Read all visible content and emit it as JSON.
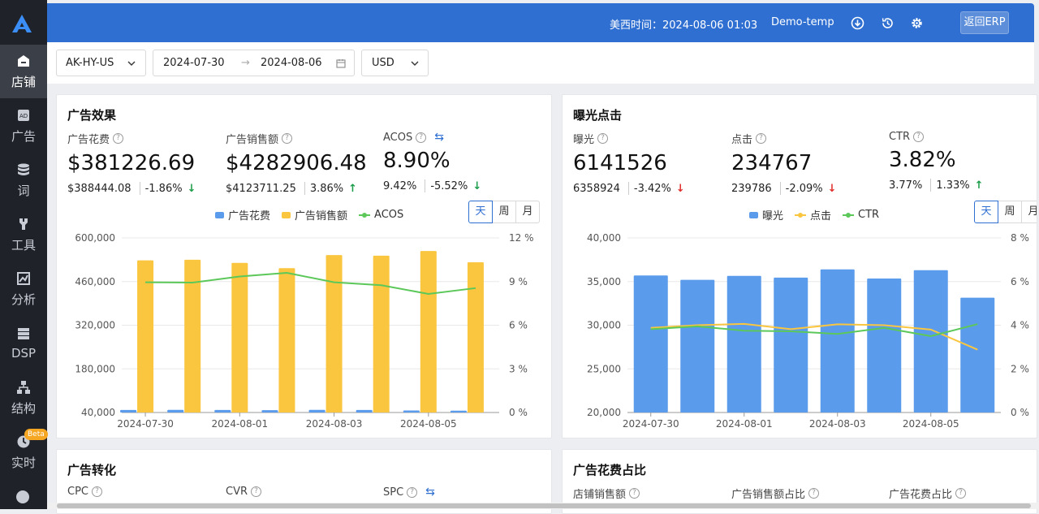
{
  "topbar": {
    "time_label": "美西时间：2024-08-06 01:03",
    "user": "Demo-temp",
    "erp_button": "返回ERP"
  },
  "sidebar": {
    "items": [
      {
        "label": "店铺",
        "icon": "store-icon"
      },
      {
        "label": "广告",
        "icon": "ad-icon"
      },
      {
        "label": "词",
        "icon": "database-icon"
      },
      {
        "label": "工具",
        "icon": "wrench-icon"
      },
      {
        "label": "分析",
        "icon": "chart-icon"
      },
      {
        "label": "DSP",
        "icon": "server-icon"
      },
      {
        "label": "结构",
        "icon": "hierarchy-icon"
      },
      {
        "label": "实时",
        "icon": "clock-icon"
      }
    ],
    "beta_badge": "Beta"
  },
  "filters": {
    "store": "AK-HY-US",
    "date_start": "2024-07-30",
    "date_end": "2024-08-06",
    "currency": "USD"
  },
  "ad_card": {
    "title": "广告效果",
    "metrics": [
      {
        "label": "广告花费",
        "value": "$381226.69",
        "prev": "$388444.08",
        "change": "-1.86%",
        "trend": "down-good"
      },
      {
        "label": "广告销售额",
        "value": "$4282906.48",
        "prev": "$4123711.25",
        "change": "3.86%",
        "trend": "up"
      },
      {
        "label": "ACOS",
        "value": "8.90%",
        "prev": "9.42%",
        "change": "-5.52%",
        "trend": "down-good"
      }
    ],
    "legend": [
      "广告花费",
      "广告销售额",
      "ACOS"
    ],
    "periods": [
      "天",
      "周",
      "月"
    ]
  },
  "imp_card": {
    "title": "曝光点击",
    "metrics": [
      {
        "label": "曝光",
        "value": "6141526",
        "prev": "6358924",
        "change": "-3.42%",
        "trend": "down"
      },
      {
        "label": "点击",
        "value": "234767",
        "prev": "239786",
        "change": "-2.09%",
        "trend": "down"
      },
      {
        "label": "CTR",
        "value": "3.82%",
        "prev": "3.77%",
        "change": "1.33%",
        "trend": "up"
      }
    ],
    "legend": [
      "曝光",
      "点击",
      "CTR"
    ],
    "periods": [
      "天",
      "周",
      "月"
    ]
  },
  "conv_card": {
    "title": "广告转化",
    "labels": [
      "CPC",
      "CVR",
      "SPC"
    ]
  },
  "share_card": {
    "title": "广告花费占比",
    "labels": [
      "店铺销售额",
      "广告销售额占比",
      "广告花费占比"
    ]
  },
  "colors": {
    "blue": "#5b9bec",
    "yellow": "#fac63f",
    "green": "#5cc85a",
    "accent": "#2f6fd1"
  },
  "chart_data": [
    {
      "type": "bar",
      "x": [
        "2024-07-30",
        "2024-07-31",
        "2024-08-01",
        "2024-08-02",
        "2024-08-03",
        "2024-08-04",
        "2024-08-05",
        "2024-08-06"
      ],
      "tick_labels": [
        "2024-07-30",
        "2024-08-01",
        "2024-08-03",
        "2024-08-05"
      ],
      "series": [
        {
          "name": "广告花费",
          "type": "bar",
          "axis": "left",
          "values": [
            48000,
            48500,
            48000,
            47500,
            48500,
            48000,
            46500,
            46000
          ]
        },
        {
          "name": "广告销售额",
          "type": "bar",
          "axis": "left",
          "values": [
            528000,
            530000,
            520000,
            503000,
            545000,
            543000,
            558000,
            522000
          ]
        },
        {
          "name": "ACOS",
          "type": "line",
          "axis": "right",
          "values": [
            8.95,
            8.93,
            9.35,
            9.6,
            8.95,
            8.75,
            8.15,
            8.55
          ]
        }
      ],
      "ylim_left": [
        40000,
        600000
      ],
      "yticks_left": [
        "600,000",
        "460,000",
        "320,000",
        "180,000",
        "40,000"
      ],
      "ylim_right": [
        0,
        12
      ],
      "yticks_right": [
        "12 %",
        "9 %",
        "6 %",
        "3 %",
        "0 %"
      ]
    },
    {
      "type": "bar",
      "x": [
        "2024-07-30",
        "2024-07-31",
        "2024-08-01",
        "2024-08-02",
        "2024-08-03",
        "2024-08-04",
        "2024-08-05",
        "2024-08-06"
      ],
      "tick_labels": [
        "2024-07-30",
        "2024-08-01",
        "2024-08-03",
        "2024-08-05"
      ],
      "series": [
        {
          "name": "曝光",
          "type": "bar",
          "axis": "left",
          "values": [
            35700,
            35200,
            35650,
            35450,
            36400,
            35350,
            36300,
            33150
          ]
        },
        {
          "name": "点击",
          "type": "line",
          "axis": "left",
          "values": [
            29700,
            30000,
            30150,
            29550,
            30100,
            30000,
            29500,
            27200
          ]
        },
        {
          "name": "CTR",
          "type": "line",
          "axis": "right",
          "values": [
            3.82,
            3.95,
            3.75,
            3.72,
            3.6,
            3.88,
            3.5,
            4.05
          ]
        }
      ],
      "ylim_left": [
        20000,
        40000
      ],
      "yticks_left": [
        "40,000",
        "35,000",
        "30,000",
        "25,000",
        "20,000"
      ],
      "ylim_right": [
        0,
        8
      ],
      "yticks_right": [
        "8 %",
        "6 %",
        "4 %",
        "2 %",
        "0 %"
      ]
    }
  ]
}
